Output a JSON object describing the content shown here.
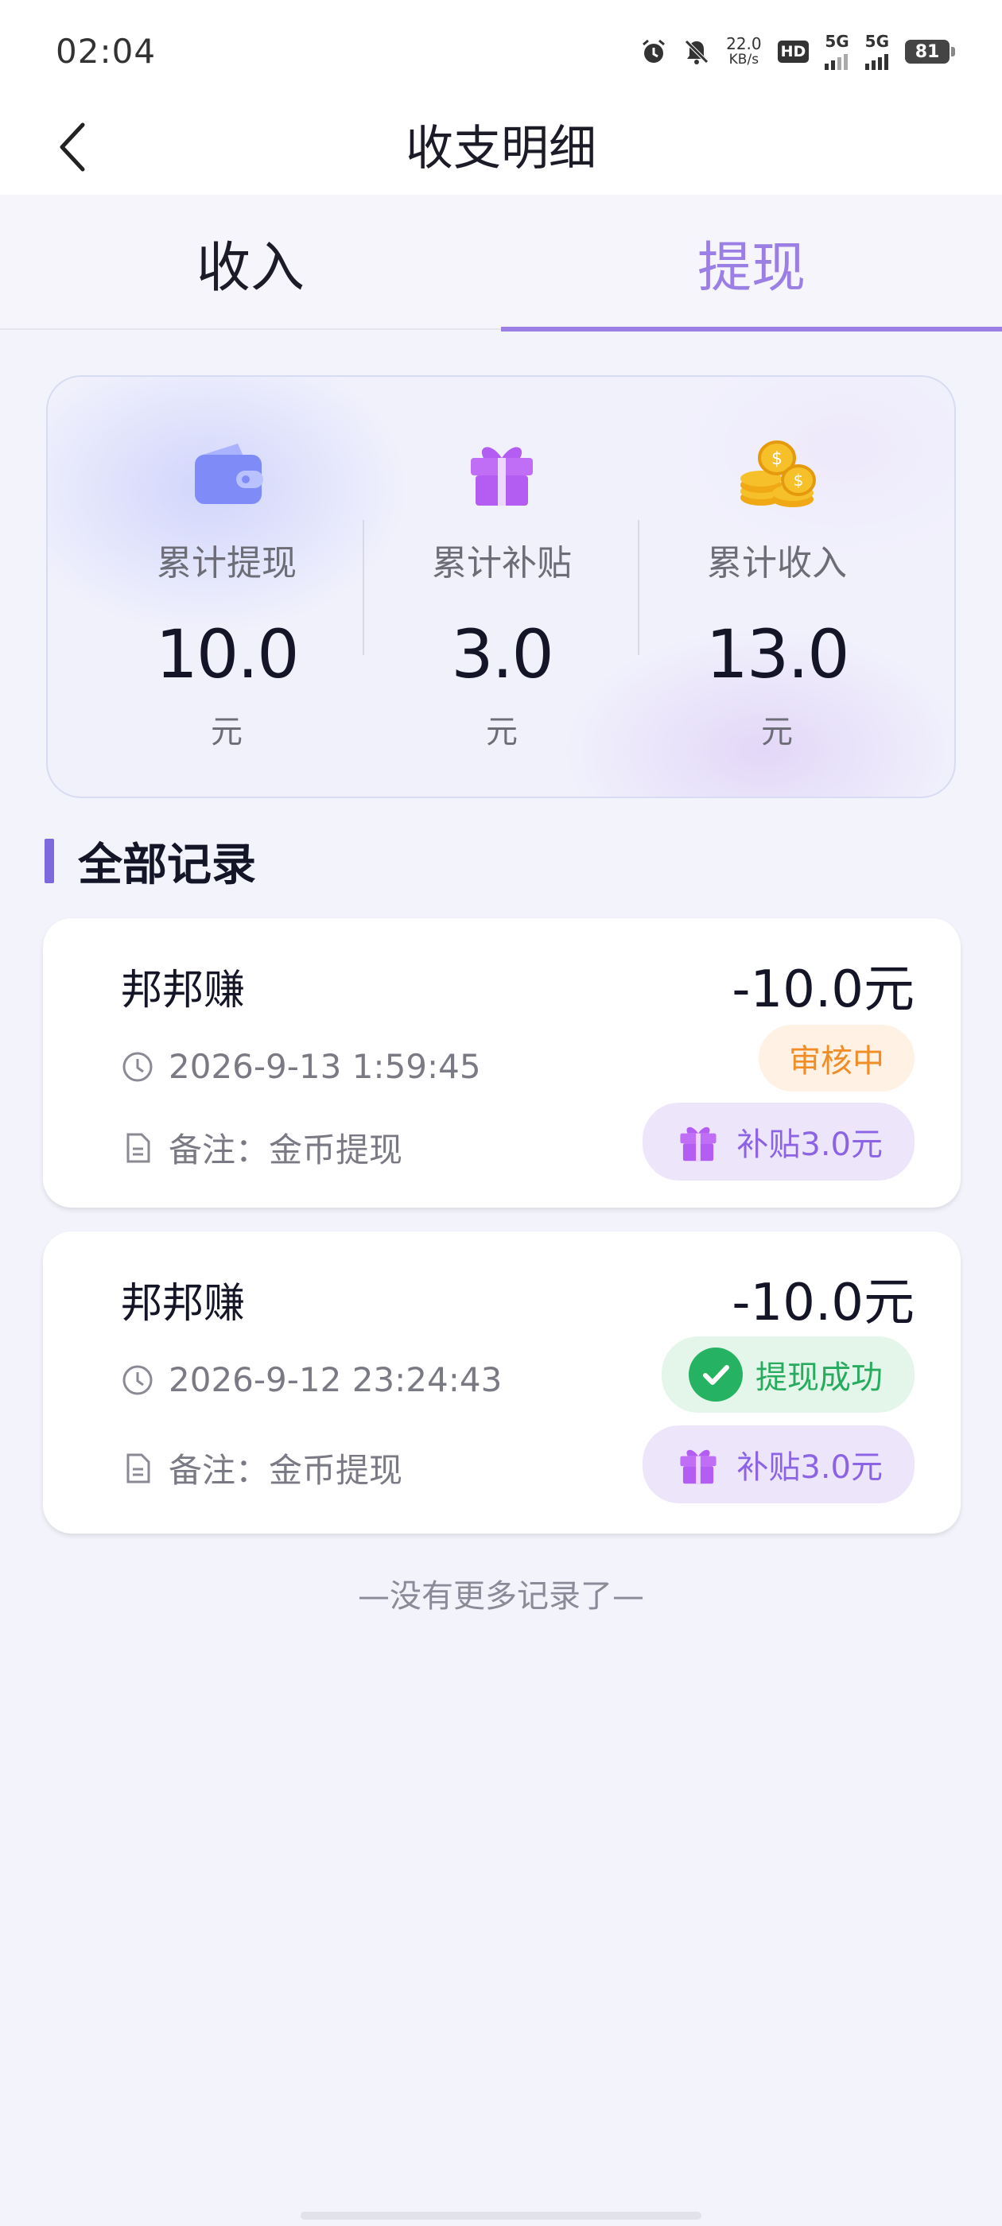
{
  "status_bar": {
    "time": "02:04",
    "net_speed_value": "22.0",
    "net_speed_unit": "KB/s",
    "hd_label": "HD",
    "sim1_label": "5G",
    "sim2_label": "5G",
    "battery": "81",
    "icons": [
      "alarm-icon",
      "mute-icon",
      "hd-icon",
      "signal-icon",
      "signal-icon",
      "battery-icon"
    ]
  },
  "header": {
    "title": "收支明细",
    "back_icon": "chevron-left-icon"
  },
  "tabs": [
    {
      "label": "收入",
      "active": false
    },
    {
      "label": "提现",
      "active": true
    }
  ],
  "summary": {
    "items": [
      {
        "label": "累计提现",
        "value": "10.0",
        "unit": "元",
        "icon": "wallet-icon"
      },
      {
        "label": "累计补贴",
        "value": "3.0",
        "unit": "元",
        "icon": "gift-icon"
      },
      {
        "label": "累计收入",
        "value": "13.0",
        "unit": "元",
        "icon": "coins-icon"
      }
    ]
  },
  "records_section": {
    "title": "全部记录"
  },
  "records": [
    {
      "name": "邦邦赚",
      "amount": "-10.0元",
      "time": "2026-9-13 1:59:45",
      "note": "备注：金币提现",
      "status": "审核中",
      "subsidy": "补贴3.0元"
    },
    {
      "name": "邦邦赚",
      "amount": "-10.0元",
      "time": "2026-9-12 23:24:43",
      "note": "备注：金币提现",
      "status": "提现成功",
      "subsidy": "补贴3.0元"
    }
  ],
  "footer": {
    "no_more": "—没有更多记录了—"
  },
  "colors": {
    "accent": "#9b7fe4",
    "section_bar": "#7d68de",
    "pending": "#f18d26",
    "success": "#25b262",
    "subsidy": "#8d63e6"
  }
}
